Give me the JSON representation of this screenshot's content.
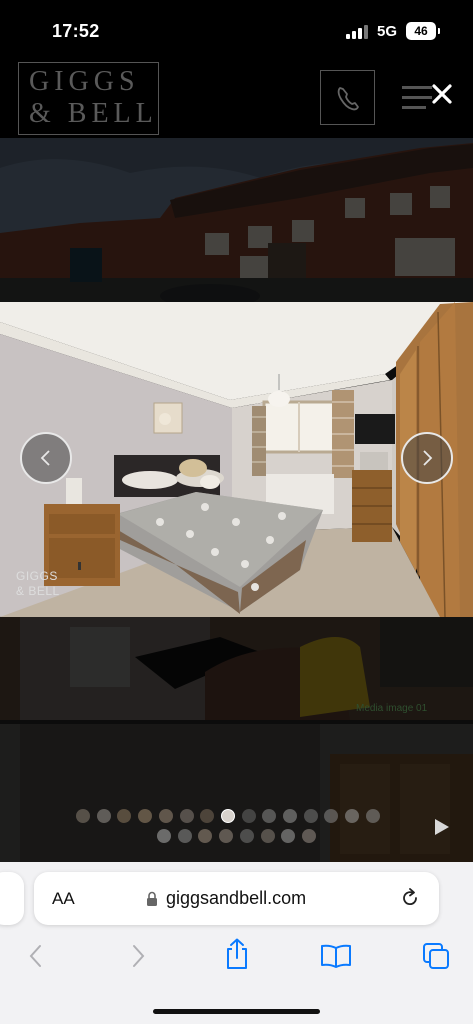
{
  "status_bar": {
    "time": "17:52",
    "network": "5G",
    "battery": "46"
  },
  "site": {
    "logo_line1": "GIGGS",
    "logo_line2": "& BELL"
  },
  "gallery": {
    "watermark_line1": "GIGGS",
    "watermark_line2": "& BELL",
    "media_label": "Media image 01",
    "dots_row1": [
      {
        "color": "#8a7f72"
      },
      {
        "color": "#9a9590"
      },
      {
        "color": "#8e7a60"
      },
      {
        "color": "#a08a70"
      },
      {
        "color": "#9c8a78"
      },
      {
        "color": "#8a8078"
      },
      {
        "color": "#7a6a5a"
      },
      {
        "color": "#d8d2cc",
        "active": true
      },
      {
        "color": "#6a6a6a"
      },
      {
        "color": "#8a8a8a"
      },
      {
        "color": "#9a9a9a"
      },
      {
        "color": "#7a7a7a"
      },
      {
        "color": "#888888"
      },
      {
        "color": "#a0a0a0"
      },
      {
        "color": "#8e8e8e"
      }
    ],
    "dots_row2": [
      {
        "color": "#b0b0b0"
      },
      {
        "color": "#909090"
      },
      {
        "color": "#a09080"
      },
      {
        "color": "#9a8e84"
      },
      {
        "color": "#7a7a7a"
      },
      {
        "color": "#8a8278"
      },
      {
        "color": "#a4a4a4"
      },
      {
        "color": "#9a9088"
      }
    ]
  },
  "browser": {
    "aa_label": "AA",
    "url": "giggsandbell.com"
  },
  "colors": {
    "accent": "#0a7aff",
    "disabled": "#b0b0b4"
  }
}
